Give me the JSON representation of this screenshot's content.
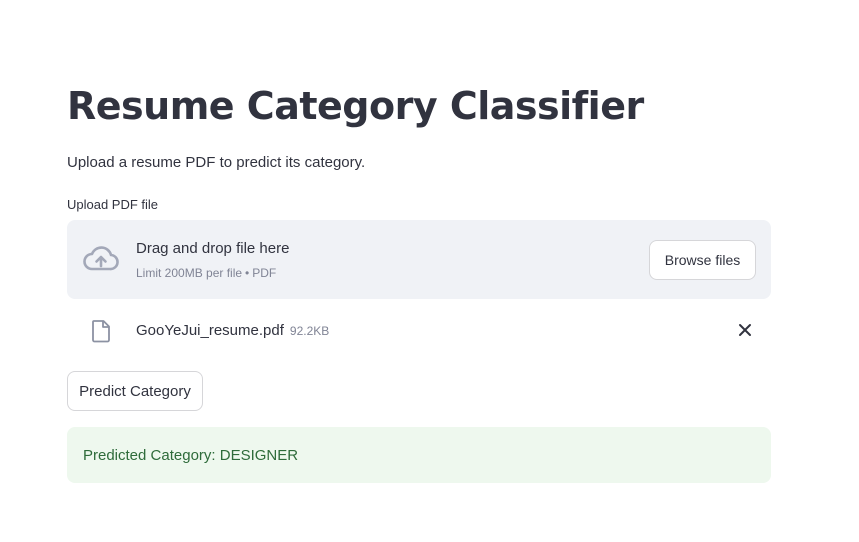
{
  "app": {
    "title": "Resume Category Classifier",
    "subtitle": "Upload a resume PDF to predict its category."
  },
  "uploader": {
    "label": "Upload PDF file",
    "dropzone_text": "Drag and drop file here",
    "limit_size": "Limit 200MB per file",
    "limit_separator": "•",
    "limit_types": "PDF",
    "browse_label": "Browse files",
    "icons": {
      "dropzone": "cloud-upload-icon",
      "file": "file-icon",
      "remove": "close-icon"
    }
  },
  "uploaded_file": {
    "name": "GooYeJui_resume.pdf",
    "size": "92.2KB"
  },
  "actions": {
    "predict_label": "Predict Category"
  },
  "result": {
    "text": "Predicted Category: DESIGNER"
  },
  "colors": {
    "text": "#31333f",
    "muted": "#808495",
    "dropzone_bg": "#f0f2f6",
    "success_bg": "#eef8ee",
    "success_text": "#2e6b3a"
  }
}
